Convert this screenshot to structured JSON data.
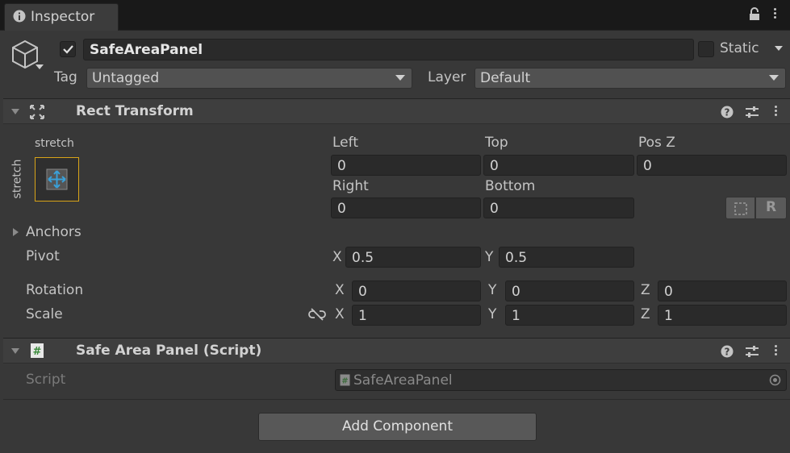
{
  "tab": {
    "label": "Inspector"
  },
  "gameobject": {
    "active": true,
    "name": "SafeAreaPanel",
    "static_label": "Static",
    "tag_label": "Tag",
    "tag_value": "Untagged",
    "layer_label": "Layer",
    "layer_value": "Default"
  },
  "rect_transform": {
    "title": "Rect Transform",
    "anchor_preset_h": "stretch",
    "anchor_preset_v": "stretch",
    "left_label": "Left",
    "left_value": "0",
    "top_label": "Top",
    "top_value": "0",
    "posz_label": "Pos Z",
    "posz_value": "0",
    "right_label": "Right",
    "right_value": "0",
    "bottom_label": "Bottom",
    "bottom_value": "0",
    "anchors_label": "Anchors",
    "pivot_label": "Pivot",
    "pivot_x_label": "X",
    "pivot_x": "0.5",
    "pivot_y_label": "Y",
    "pivot_y": "0.5",
    "rotation_label": "Rotation",
    "rot_x": "0",
    "rot_y": "0",
    "rot_z": "0",
    "scale_label": "Scale",
    "scale_x": "1",
    "scale_y": "1",
    "scale_z": "1",
    "x": "X",
    "y": "Y",
    "z": "Z"
  },
  "script_component": {
    "title": "Safe Area Panel (Script)",
    "script_label": "Script",
    "script_value": "SafeAreaPanel"
  },
  "add_component": {
    "label": "Add Component"
  },
  "colors": {
    "background": "#383838",
    "field": "#2a2a2a",
    "accent_anchor": "#d8a418",
    "accent_blue": "#3aa0d8",
    "check_green": "#5fb04a"
  }
}
